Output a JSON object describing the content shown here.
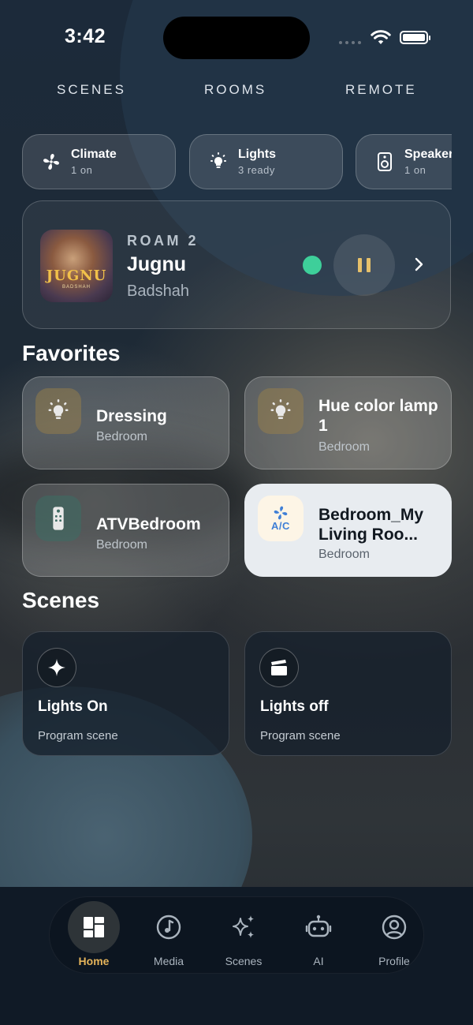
{
  "status": {
    "time": "3:42"
  },
  "topnav": [
    "SCENES",
    "ROOMS",
    "REMOTE"
  ],
  "chips": [
    {
      "icon": "fan-icon",
      "label": "Climate",
      "sub": "1 on"
    },
    {
      "icon": "lightbulb-icon",
      "label": "Lights",
      "sub": "3 ready"
    },
    {
      "icon": "speaker-icon",
      "label": "Speakers",
      "sub": "1 on"
    }
  ],
  "player": {
    "room": "ROAM 2",
    "song": "Jugnu",
    "artist": "Badshah",
    "art_title": "JUGNU",
    "art_sub": "BADSHAH",
    "status_color": "#3ecf9a"
  },
  "favorites_title": "Favorites",
  "favorites": [
    {
      "name": "Dressing",
      "room": "Bedroom",
      "icon": "lightbulb-icon",
      "active": false
    },
    {
      "name": "Hue color lamp 1",
      "room": "Bedroom",
      "icon": "lightbulb-icon",
      "active": false
    },
    {
      "name": "ATVBedroom",
      "room": "Bedroom",
      "icon": "remote-icon",
      "active": false
    },
    {
      "name": "Bedroom_My Living Roo...",
      "room": "Bedroom",
      "icon": "ac-icon",
      "ac_label": "A/C",
      "active": true
    }
  ],
  "scenes_title": "Scenes",
  "scenes": [
    {
      "name": "Lights On",
      "sub": "Program scene",
      "icon": "sparkle-icon"
    },
    {
      "name": "Lights off",
      "sub": "Program scene",
      "icon": "clapperboard-icon"
    }
  ],
  "tabs": [
    {
      "label": "Home",
      "icon": "home-grid-icon",
      "active": true
    },
    {
      "label": "Media",
      "icon": "music-note-icon",
      "active": false
    },
    {
      "label": "Scenes",
      "icon": "sparkles-icon",
      "active": false
    },
    {
      "label": "AI",
      "icon": "robot-icon",
      "active": false
    },
    {
      "label": "Profile",
      "icon": "profile-icon",
      "active": false
    }
  ],
  "colors": {
    "accent": "#e5b45a",
    "active_card": "#e8ecf0"
  }
}
